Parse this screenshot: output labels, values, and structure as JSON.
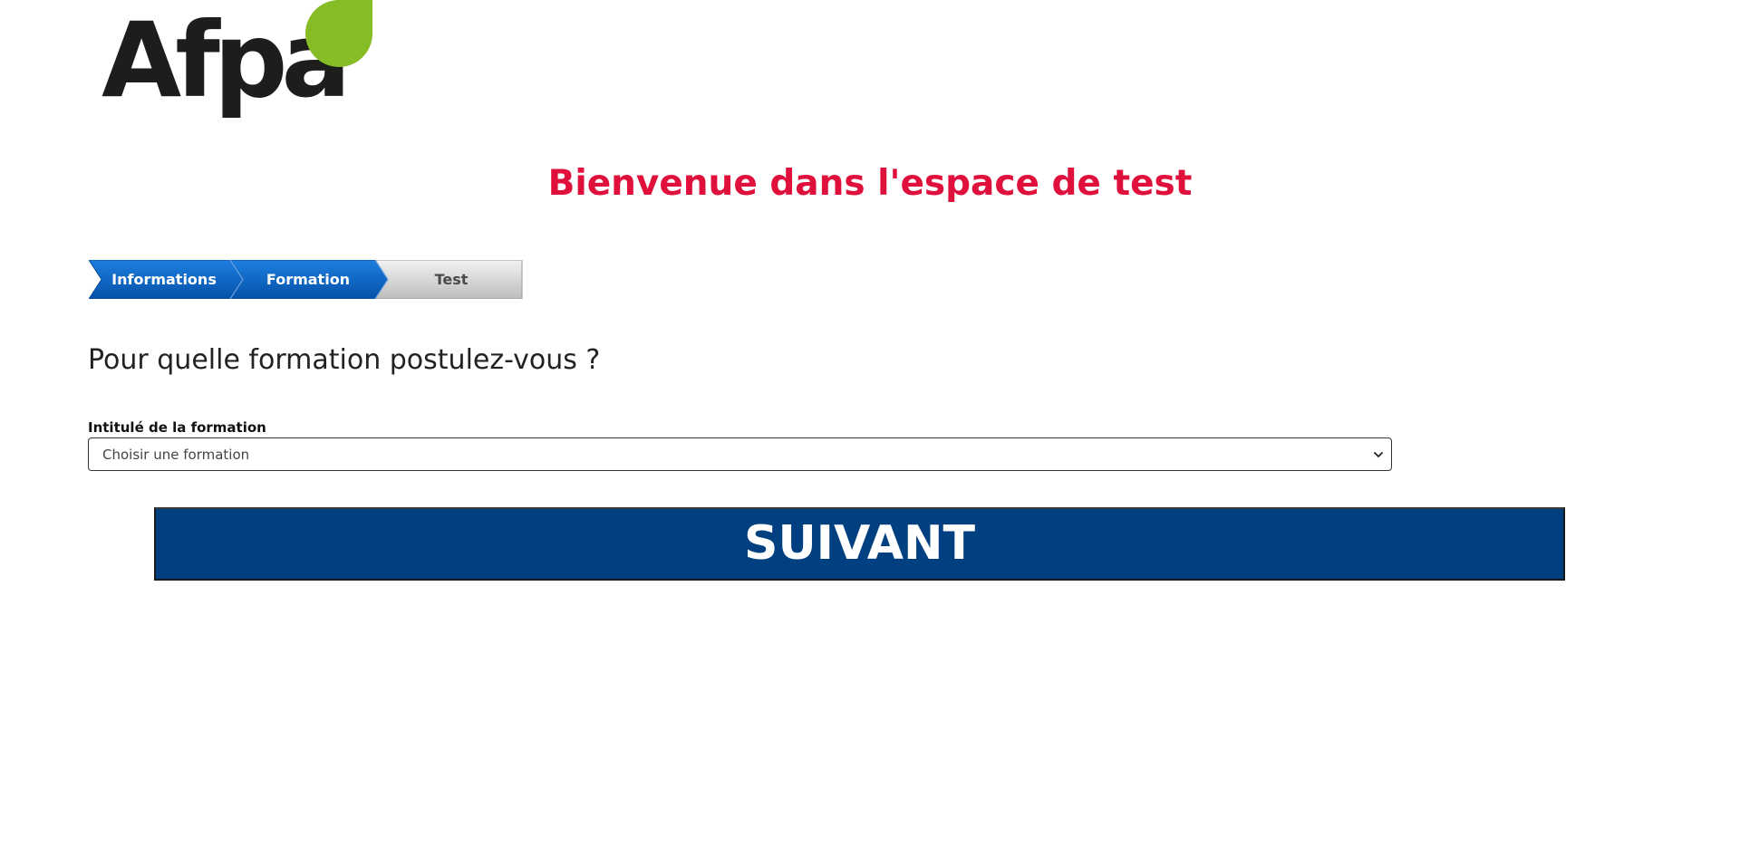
{
  "brand": {
    "logo_text": "Afpa",
    "text_color": "#1d1d1b",
    "leaf_color": "#86bc25"
  },
  "header": {
    "title": "Bienvenue dans l'espace de test",
    "title_color": "#e0103c"
  },
  "stepper": {
    "steps": [
      {
        "label": "Informations",
        "state": "completed"
      },
      {
        "label": "Formation",
        "state": "active"
      },
      {
        "label": "Test",
        "state": "pending"
      }
    ],
    "active_color": "#0a5cb8",
    "pending_color": "#d4d4d4"
  },
  "form": {
    "question": "Pour quelle formation postulez-vous ?",
    "field_label": "Intitulé de la formation",
    "select_value": "Choisir une formation"
  },
  "actions": {
    "next_label": "SUIVANT",
    "next_color": "#003f80"
  }
}
